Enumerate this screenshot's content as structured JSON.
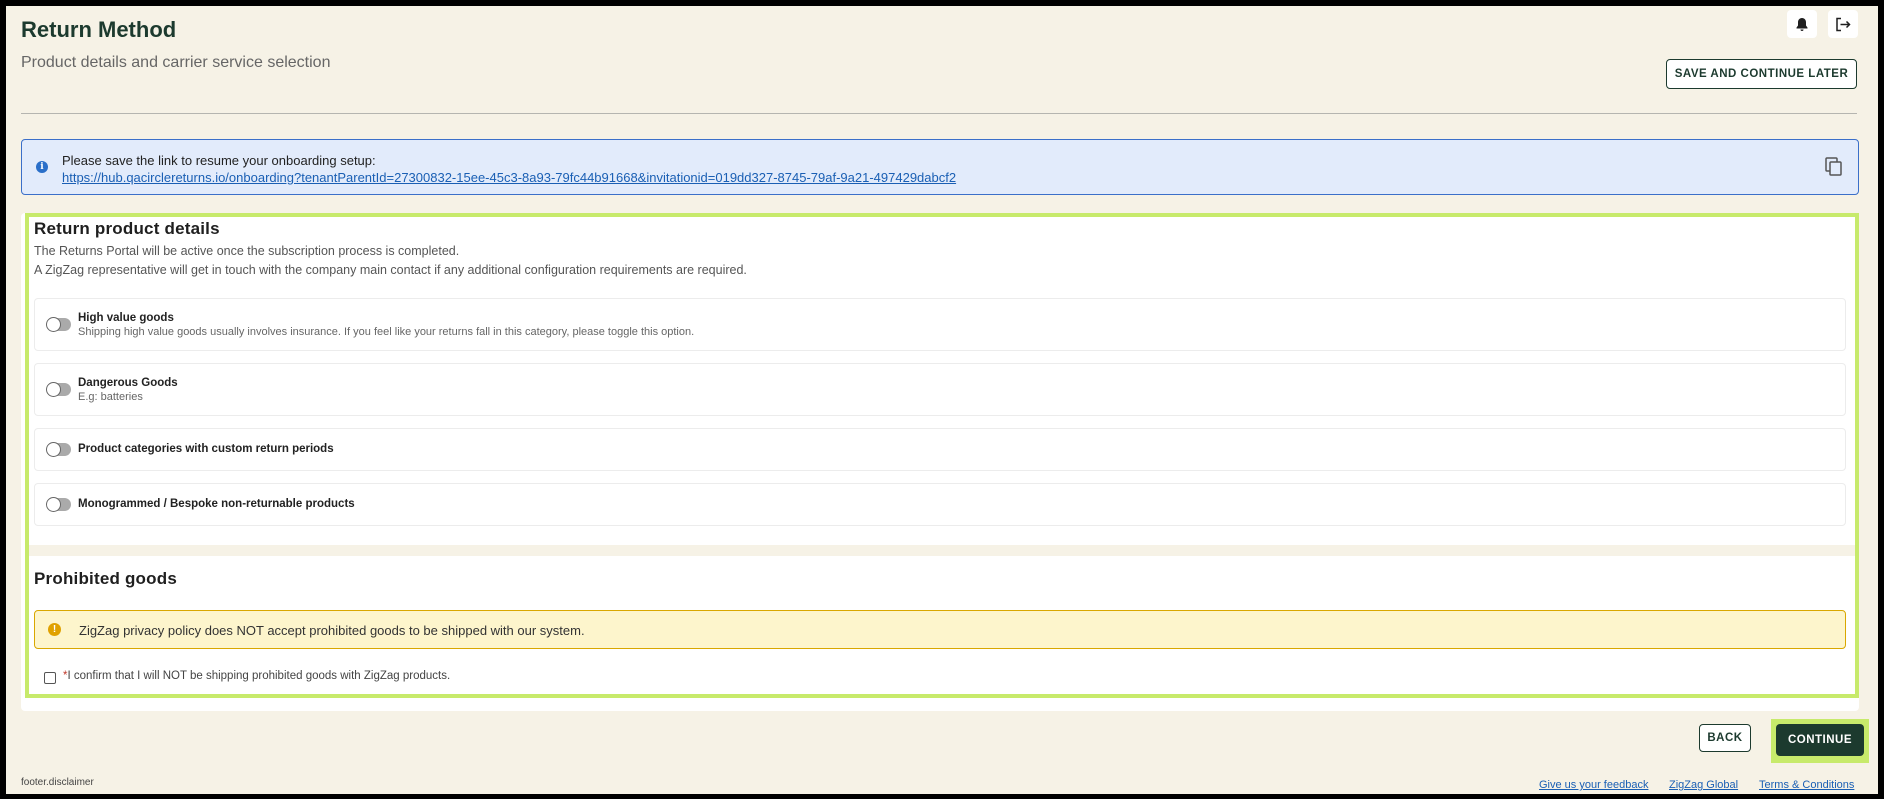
{
  "header": {
    "title": "Return Method",
    "subtitle": "Product details and carrier service selection",
    "save_later_label": "SAVE AND CONTINUE LATER",
    "icons": [
      "bell-icon",
      "logout-icon"
    ]
  },
  "info_banner": {
    "message": "Please save the link to resume your onboarding setup:",
    "link": "https://hub.qacirclereturns.io/onboarding?tenantParentId=27300832-15ee-45c3-8a93-79fc44b91668&invitationid=019dd327-8745-79af-9a21-497429dabcf2"
  },
  "return_product_details": {
    "title": "Return product details",
    "desc_1": "The Returns Portal will be active once the subscription process is completed.",
    "desc_2": "A ZigZag representative will get in touch with the company main contact if any additional configuration requirements are required.",
    "options": [
      {
        "label": "High value goods",
        "description": "Shipping high value goods usually involves insurance. If you feel like your returns fall in this category, please toggle this option.",
        "enabled": false
      },
      {
        "label": "Dangerous Goods",
        "description": "E.g: batteries",
        "enabled": false
      },
      {
        "label": "Product categories with custom return periods",
        "enabled": false
      },
      {
        "label": "Monogrammed / Bespoke non-returnable products",
        "enabled": false
      }
    ]
  },
  "prohibited_goods": {
    "title": "Prohibited goods",
    "warning": "ZigZag privacy policy does NOT accept prohibited goods to be shipped with our system.",
    "confirm_required_mark": "*",
    "confirm_label": "I confirm that I will NOT be shipping prohibited goods with ZigZag products.",
    "confirmed": false
  },
  "actions": {
    "back_label": "BACK",
    "continue_label": "CONTINUE"
  },
  "footer": {
    "disclaimer": "footer.disclaimer",
    "feedback_link": "Give us your feedback",
    "global_link": "ZigZag Global",
    "terms_link": "Terms & Conditions"
  },
  "colors": {
    "background": "#f6f2e6",
    "brand_dark": "#1c3a2e",
    "highlight": "#c7ea6b",
    "info_bg": "#e2ebfb",
    "warning_bg": "#fdf5cc"
  }
}
